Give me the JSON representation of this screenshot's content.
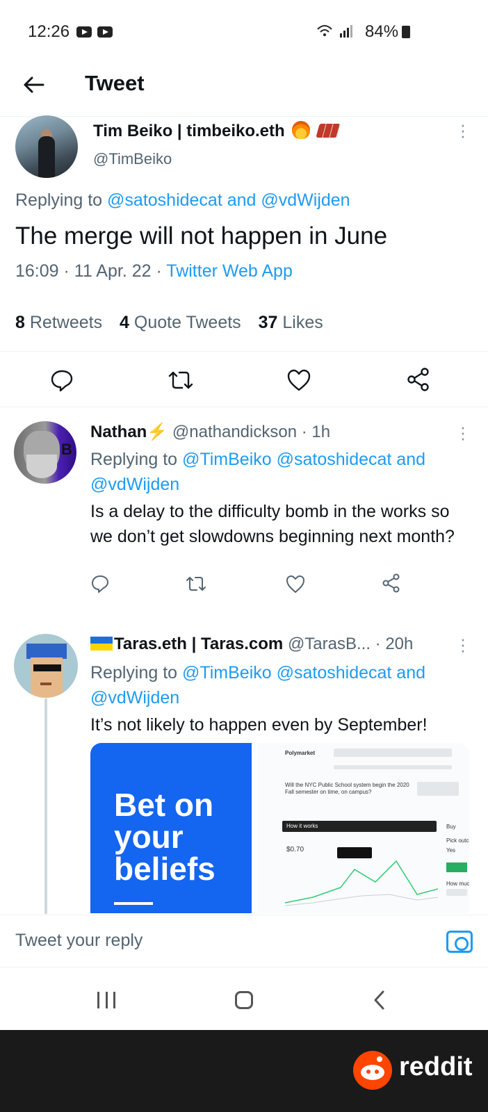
{
  "status_bar": {
    "time": "12:26",
    "battery": "84%"
  },
  "header": {
    "back_icon": "arrow-left-icon",
    "title": "Tweet"
  },
  "main_tweet": {
    "name": "Tim Beiko | timbeiko.eth",
    "handle": "@TimBeiko",
    "replying_prefix": "Replying to",
    "replying_to": "@satoshidecat and @vdWijden",
    "text": "The merge will not happen in June",
    "time": "16:09",
    "date": "11 Apr. 22",
    "source": "Twitter Web App",
    "stats": {
      "retweets_count": "8",
      "retweets_label": "Retweets",
      "quotes_count": "4",
      "quotes_label": "Quote Tweets",
      "likes_count": "37",
      "likes_label": "Likes"
    }
  },
  "replies": [
    {
      "name": "Nathan",
      "handle": "@nathandickson",
      "age": "1h",
      "replying_prefix": "Replying to",
      "replying_to": "@TimBeiko @satoshidecat and @vdWijden",
      "text": "Is a delay to the difficulty bomb in the works so we don’t get slowdowns beginning next month?"
    },
    {
      "name": "Taras.eth | Taras.com",
      "handle": "@TarasB...",
      "age": "20h",
      "replying_prefix": "Replying to",
      "replying_to": "@TimBeiko @satoshidecat and @vdWijden",
      "text": "It’s not likely to happen even by September!",
      "card": {
        "headline": "Bet on your beliefs",
        "brand": "Polymarket",
        "question": "Will the NYC Public School system begin the 2020 Fall semester on time, on campus?",
        "how_it_works": "How it works",
        "price": "$0.70",
        "buy": "Buy",
        "pick_outcome": "Pick outcome",
        "yes": "Yes",
        "how_much": "How much?"
      }
    }
  ],
  "reply_box": {
    "placeholder": "Tweet your reply"
  },
  "footer": {
    "brand": "reddit"
  }
}
